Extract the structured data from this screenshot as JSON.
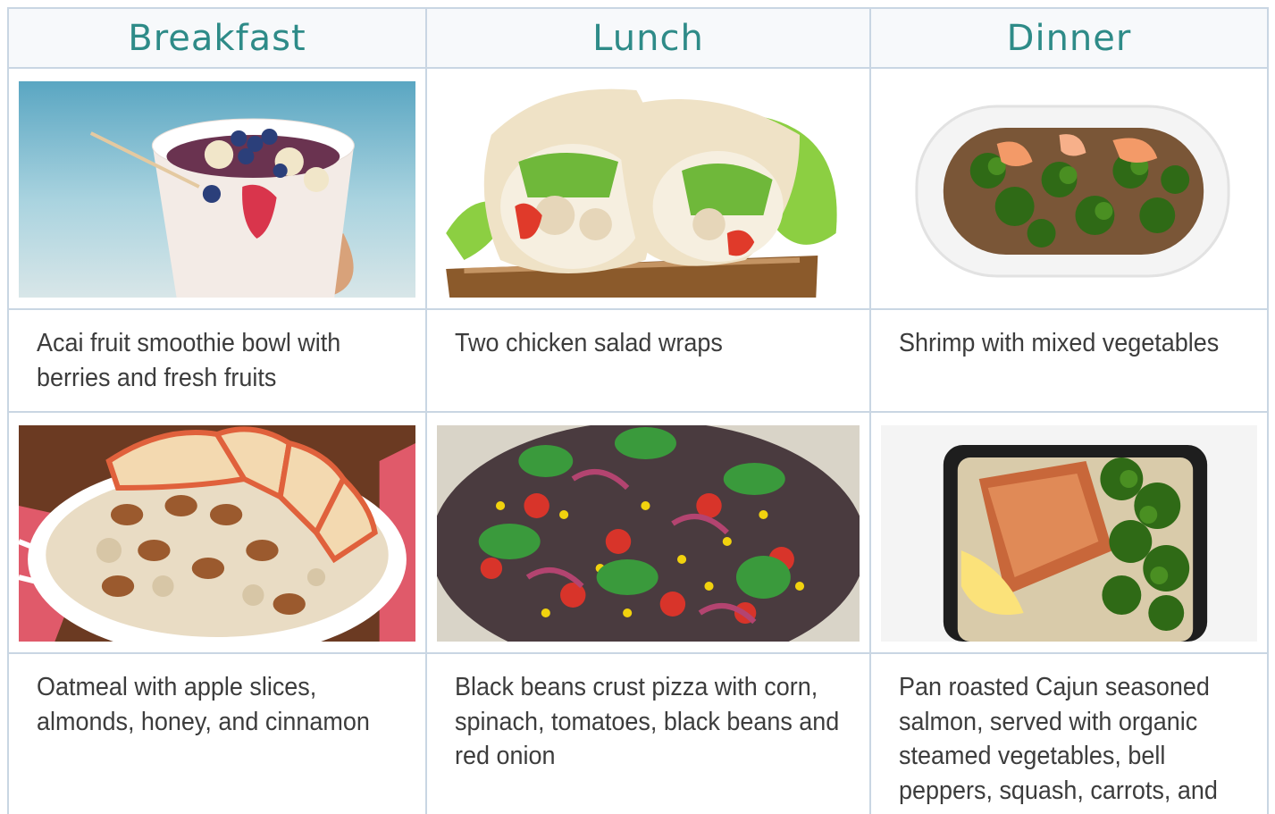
{
  "headers": [
    "Breakfast",
    "Lunch",
    "Dinner"
  ],
  "row1": {
    "images": [
      "acai-bowl-image",
      "chicken-wrap-image",
      "shrimp-vegetables-image"
    ],
    "descriptions": [
      "Acai fruit smoothie bowl with berries and fresh fruits",
      "Two chicken salad wraps",
      "Shrimp with mixed vegetables"
    ]
  },
  "row2": {
    "images": [
      "oatmeal-image",
      "black-bean-pizza-image",
      "cajun-salmon-image"
    ],
    "descriptions": [
      "Oatmeal with apple slices, almonds, honey, and cinnamon",
      "Black beans crust pizza with corn, spinach, tomatoes, black beans and red onion",
      "Pan roasted Cajun seasoned salmon, served with organic steamed vegetables, bell peppers, squash, carrots, and zucchini"
    ]
  },
  "colors": {
    "header_text": "#2e8b88",
    "border": "#c9d6e3",
    "body_text": "#3c3c3c"
  }
}
